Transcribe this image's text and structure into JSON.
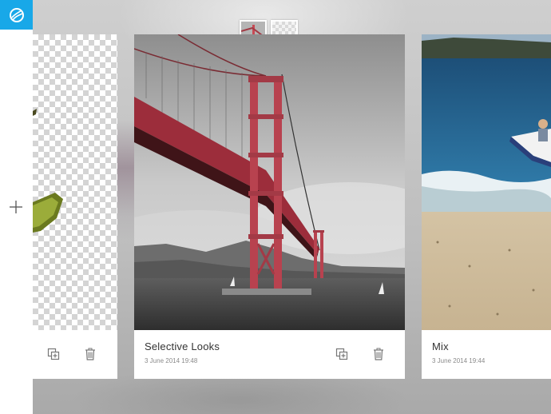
{
  "app": {
    "logo_icon": "app-logo-icon",
    "brand_color": "#18a8e8"
  },
  "sidebar": {
    "add_icon": "plus-icon"
  },
  "layers": [
    {
      "name": "photo-layer",
      "icon": "layer-thumbnail"
    },
    {
      "name": "empty-layer",
      "icon": "transparent-layer-thumbnail"
    }
  ],
  "cards": [
    {
      "title": "",
      "date": "",
      "actions": [
        "duplicate-icon",
        "trash-icon"
      ]
    },
    {
      "title": "Selective Looks",
      "date": "3 June 2014 19:48",
      "actions": [
        "duplicate-icon",
        "trash-icon"
      ]
    },
    {
      "title": "Mix",
      "date": "3 June 2014 19:44",
      "actions": []
    }
  ]
}
